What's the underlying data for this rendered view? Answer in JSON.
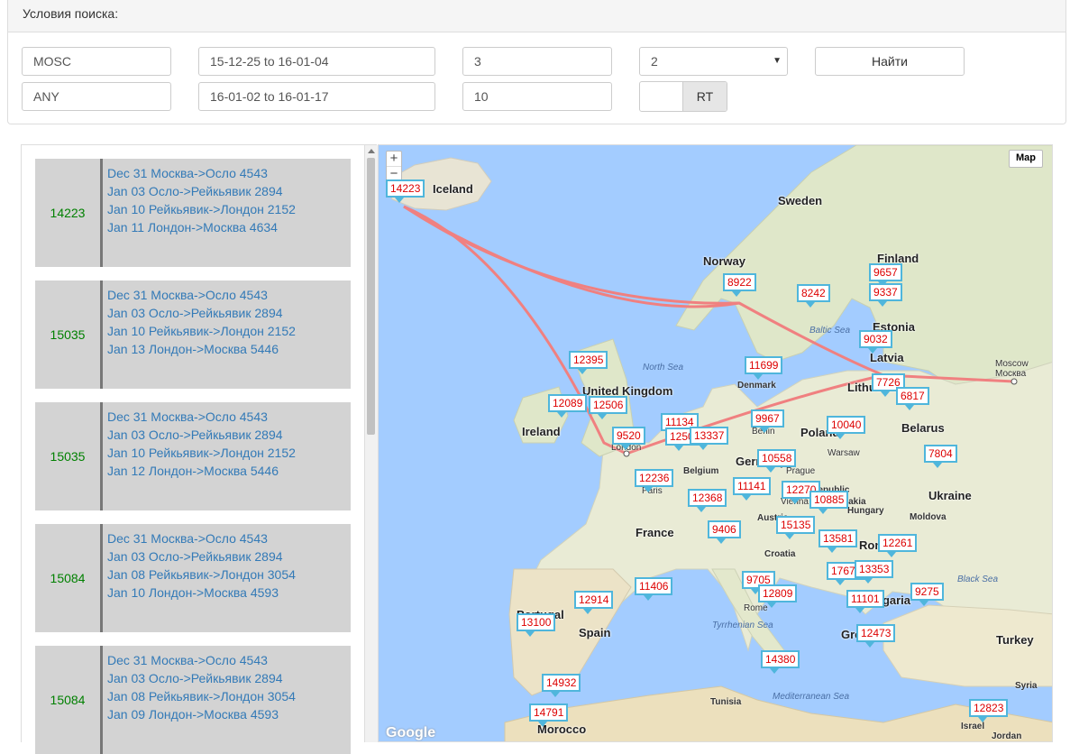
{
  "search_panel": {
    "title": "Условия поиска:",
    "origin": "MOSC",
    "destination": "ANY",
    "date_range_out": "15-12-25 to 16-01-04",
    "date_range_back": "16-01-02 to 16-01-17",
    "min_value": "3",
    "max_value": "10",
    "select_value": "2",
    "search_button": "Найти",
    "toggle_label": "RT"
  },
  "results": [
    {
      "price": "14223",
      "legs": [
        "Dec 31 Москва->Осло 4543",
        "Jan 03 Осло->Рейкьявик 2894",
        "Jan 10 Рейкьявик->Лондон 2152",
        "Jan 11 Лондон->Москва 4634"
      ]
    },
    {
      "price": "15035",
      "legs": [
        "Dec 31 Москва->Осло 4543",
        "Jan 03 Осло->Рейкьявик 2894",
        "Jan 10 Рейкьявик->Лондон 2152",
        "Jan 13 Лондон->Москва 5446"
      ]
    },
    {
      "price": "15035",
      "legs": [
        "Dec 31 Москва->Осло 4543",
        "Jan 03 Осло->Рейкьявик 2894",
        "Jan 10 Рейкьявик->Лондон 2152",
        "Jan 12 Лондон->Москва 5446"
      ]
    },
    {
      "price": "15084",
      "legs": [
        "Dec 31 Москва->Осло 4543",
        "Jan 03 Осло->Рейкьявик 2894",
        "Jan 08 Рейкьявик->Лондон 3054",
        "Jan 10 Лондон->Москва 4593"
      ]
    },
    {
      "price": "15084",
      "legs": [
        "Dec 31 Москва->Осло 4543",
        "Jan 03 Осло->Рейкьявик 2894",
        "Jan 08 Рейкьявик->Лондон 3054",
        "Jan 09 Лондон->Москва 4593"
      ]
    }
  ],
  "map": {
    "map_type_button": "Map",
    "zoom_in": "+",
    "zoom_out": "−",
    "logo": "Google",
    "route_color": "#f08080",
    "marker_border_color": "#4fb6dc",
    "marker_text_color": "#dd0000",
    "price_markers": [
      "14223",
      "9657",
      "9337",
      "8922",
      "8242",
      "9032",
      "12395",
      "11699",
      "7726",
      "6817",
      "12089",
      "12506",
      "9967",
      "11134",
      "10040",
      "9520",
      "12500",
      "13337",
      "10558",
      "7804",
      "12236",
      "11141",
      "12270",
      "10885",
      "12368",
      "9406",
      "15135",
      "13581",
      "12261",
      "17679",
      "13353",
      "9705",
      "12809",
      "11406",
      "12914",
      "11101",
      "9275",
      "13100",
      "12473",
      "14380",
      "14932",
      "14791",
      "12823"
    ],
    "country_labels": [
      "Iceland",
      "Sweden",
      "Norway",
      "Finland",
      "Estonia",
      "Latvia",
      "Lithuania",
      "Denmark",
      "United Kingdom",
      "Ireland",
      "Belarus",
      "Poland",
      "Germany",
      "Ukraine",
      "Moldova",
      "France",
      "Hungary",
      "Croatia",
      "Romania",
      "Bulgaria",
      "Greece",
      "Spain",
      "Portugal",
      "Turkey",
      "Morocco",
      "Tunisia",
      "Syria",
      "Israel",
      "Jordan",
      "Belgium",
      "Slovakia",
      "Austria",
      "Czech Republic"
    ],
    "city_labels": [
      "Moscow",
      "Москва",
      "Warsaw",
      "Berlin",
      "Prague",
      "Vienna",
      "London",
      "Paris",
      "Rome"
    ],
    "water_labels": [
      "North Sea",
      "Baltic Sea",
      "Black Sea",
      "Tyrrhenian Sea",
      "Mediterranean Sea"
    ]
  }
}
